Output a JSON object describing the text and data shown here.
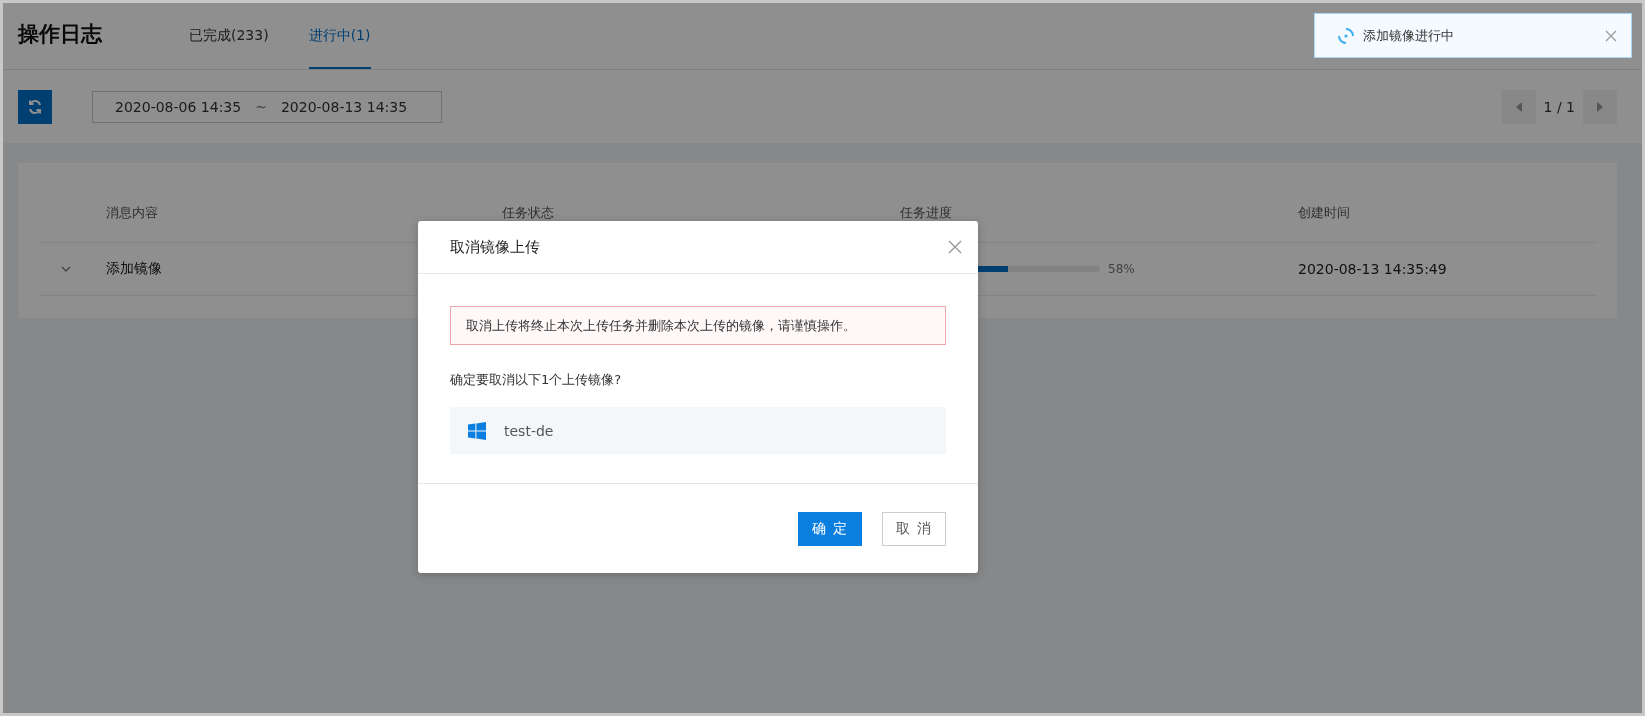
{
  "page": {
    "title": "操作日志",
    "tabs": [
      {
        "label": "已完成(233)",
        "selected": false
      },
      {
        "label": "进行中(1)",
        "selected": true
      }
    ]
  },
  "toolbar": {
    "date_start": "2020-08-06 14:35",
    "date_separator": "~",
    "date_end": "2020-08-13 14:35",
    "pagination": "1 / 1"
  },
  "table": {
    "columns": [
      "消息内容",
      "任务状态",
      "任务进度",
      "创建时间"
    ],
    "rows": [
      {
        "expanded": false,
        "message": "添加镜像",
        "progress": {
          "level": 0.58,
          "reading": "58%"
        },
        "created": "2020-08-13 14:35:49"
      }
    ]
  },
  "dialog": {
    "title": "取消镜像上传",
    "warning": "取消上传将终止本次上传任务并删除本次上传的镜像，请谨慎操作。",
    "question": "确定要取消以下1个上传镜像?",
    "items": [
      {
        "kind": "windows",
        "name": "test-de"
      }
    ],
    "buttons": [
      {
        "label": "确 定",
        "kind": "primary"
      },
      {
        "label": "取 消",
        "kind": "default"
      }
    ]
  },
  "toast": {
    "message": "添加镜像进行中"
  }
}
